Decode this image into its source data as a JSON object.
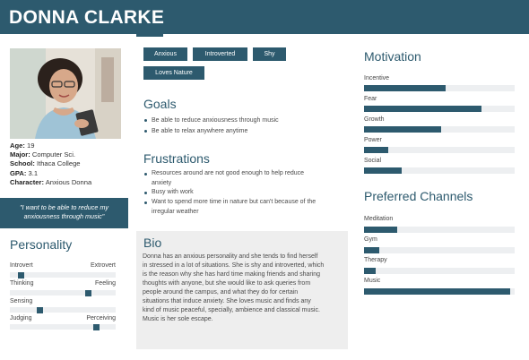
{
  "header": {
    "title": "DONNA CLARKE"
  },
  "profile": {
    "facts": [
      {
        "label": "Age:",
        "value": "19"
      },
      {
        "label": "Major:",
        "value": "Computer Sci."
      },
      {
        "label": "School:",
        "value": "Ithaca College"
      },
      {
        "label": "GPA:",
        "value": "3.1"
      },
      {
        "label": "Character:",
        "value": "Anxious Donna"
      }
    ],
    "quote": [
      "\"I want to be able to reduce my",
      "anxiousness through music\""
    ]
  },
  "personality": {
    "title": "Personality",
    "scales": [
      {
        "left": "Introvert",
        "right": "Extrovert",
        "value": 0.08
      },
      {
        "left": "Thinking",
        "right": "Feeling",
        "value": 0.76
      },
      {
        "left": "Sensing",
        "right": "",
        "value": 0.27
      },
      {
        "left": "Judging",
        "right": "Perceiving",
        "value": 0.84
      }
    ]
  },
  "tags": [
    "Anxious",
    "Introverted",
    "Shy",
    "Loves Nature"
  ],
  "goals": {
    "title": "Goals",
    "items": [
      "Be able to reduce anxiousness through music",
      "Be able to relax anywhere anytime"
    ]
  },
  "frustrations": {
    "title": "Frustrations",
    "items": [
      [
        "Resources around are not good enough to help reduce",
        "anxiety"
      ],
      [
        "Busy with work"
      ],
      [
        "Want to spend more time in nature but can't because of the",
        "irregular weather"
      ]
    ]
  },
  "bio": {
    "title": "Bio",
    "lines": [
      "Donna has an anxious personality and she tends to find herself",
      "in stressed in a lot of situations. She is shy and introverted, which",
      "is the reason why she has hard time making friends and sharing",
      "thoughts with anyone, but she would like to ask queries from",
      "people around the campus, and what they do for certain",
      "situations that induce anxiety. She loves music and finds any",
      "kind of music peaceful, specially, ambience and classical music.",
      "Music is her sole escape."
    ]
  },
  "motivation": {
    "title": "Motivation",
    "items": [
      {
        "label": "Incentive",
        "value": 0.54
      },
      {
        "label": "Fear",
        "value": 0.78
      },
      {
        "label": "Growth",
        "value": 0.51
      },
      {
        "label": "Power",
        "value": 0.16
      },
      {
        "label": "Social",
        "value": 0.25
      }
    ]
  },
  "channels": {
    "title": "Preferred Channels",
    "items": [
      {
        "label": "Meditation",
        "value": 0.22
      },
      {
        "label": "Gym",
        "value": 0.1
      },
      {
        "label": "Therapy",
        "value": 0.08
      },
      {
        "label": "Music",
        "value": 0.97
      }
    ]
  },
  "colors": {
    "accent": "#2d5a6e",
    "track": "#edeff1",
    "panel": "#eeeeee"
  }
}
